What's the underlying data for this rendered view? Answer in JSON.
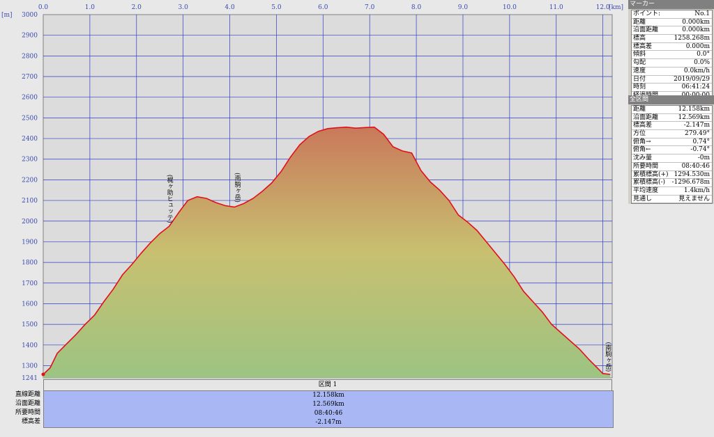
{
  "chart_data": {
    "type": "area",
    "xlabel_unit": "[km]",
    "ylabel_unit": "[m]",
    "xlim": [
      0.0,
      12.2
    ],
    "ylim": [
      1241,
      3000
    ],
    "x_ticks": [
      "0.0",
      "1.0",
      "2.0",
      "3.0",
      "4.0",
      "5.0",
      "6.0",
      "7.0",
      "8.0",
      "9.0",
      "10.0",
      "11.0",
      "12.0"
    ],
    "y_ticks": [
      "3000",
      "2900",
      "2800",
      "2700",
      "2600",
      "2500",
      "2400",
      "2300",
      "2200",
      "2100",
      "2000",
      "1900",
      "1800",
      "1700",
      "1600",
      "1500",
      "1400",
      "1300",
      "1241"
    ],
    "profile": [
      [
        0.0,
        1258
      ],
      [
        0.15,
        1290
      ],
      [
        0.3,
        1360
      ],
      [
        0.5,
        1405
      ],
      [
        0.7,
        1450
      ],
      [
        0.9,
        1500
      ],
      [
        1.1,
        1545
      ],
      [
        1.3,
        1610
      ],
      [
        1.5,
        1670
      ],
      [
        1.7,
        1740
      ],
      [
        1.9,
        1790
      ],
      [
        2.1,
        1845
      ],
      [
        2.3,
        1895
      ],
      [
        2.5,
        1940
      ],
      [
        2.7,
        1975
      ],
      [
        2.9,
        2040
      ],
      [
        3.1,
        2100
      ],
      [
        3.3,
        2118
      ],
      [
        3.5,
        2110
      ],
      [
        3.7,
        2090
      ],
      [
        3.9,
        2075
      ],
      [
        4.1,
        2068
      ],
      [
        4.3,
        2085
      ],
      [
        4.5,
        2110
      ],
      [
        4.7,
        2145
      ],
      [
        4.9,
        2185
      ],
      [
        5.1,
        2240
      ],
      [
        5.3,
        2310
      ],
      [
        5.5,
        2370
      ],
      [
        5.7,
        2410
      ],
      [
        5.9,
        2435
      ],
      [
        6.1,
        2448
      ],
      [
        6.3,
        2452
      ],
      [
        6.5,
        2455
      ],
      [
        6.7,
        2450
      ],
      [
        6.9,
        2453
      ],
      [
        7.1,
        2455
      ],
      [
        7.3,
        2420
      ],
      [
        7.5,
        2360
      ],
      [
        7.7,
        2340
      ],
      [
        7.9,
        2330
      ],
      [
        8.1,
        2245
      ],
      [
        8.3,
        2190
      ],
      [
        8.5,
        2150
      ],
      [
        8.7,
        2100
      ],
      [
        8.9,
        2030
      ],
      [
        9.1,
        1995
      ],
      [
        9.3,
        1955
      ],
      [
        9.5,
        1900
      ],
      [
        9.7,
        1845
      ],
      [
        9.9,
        1790
      ],
      [
        10.1,
        1730
      ],
      [
        10.3,
        1660
      ],
      [
        10.5,
        1610
      ],
      [
        10.7,
        1560
      ],
      [
        10.9,
        1500
      ],
      [
        11.1,
        1460
      ],
      [
        11.3,
        1420
      ],
      [
        11.5,
        1380
      ],
      [
        11.7,
        1330
      ],
      [
        11.9,
        1285
      ],
      [
        12.0,
        1262
      ],
      [
        12.158,
        1258
      ]
    ],
    "annotations": [
      {
        "x": 2.7,
        "y": 1990,
        "label": "(梶ヶ助ヒュッテ)"
      },
      {
        "x": 4.15,
        "y": 2090,
        "label": "(南駒ヶ岳)"
      },
      {
        "x": 12.1,
        "y": 1270,
        "label": "(南駒ヶ岳)"
      }
    ]
  },
  "marker_panel": {
    "title": "マーカー",
    "rows": [
      {
        "label": "ポイント:",
        "value": "No.1"
      },
      {
        "label": "距離",
        "value": "0.000km"
      },
      {
        "label": "沿面距離",
        "value": "0.000km"
      },
      {
        "label": "標高",
        "value": "1258.268m"
      },
      {
        "label": "標高差",
        "value": "0.000m"
      },
      {
        "label": "傾斜",
        "value": "0.0°"
      },
      {
        "label": "勾配",
        "value": "0.0%"
      },
      {
        "label": "速度",
        "value": "0.0km/h"
      },
      {
        "label": "日付",
        "value": "2019/09/29"
      },
      {
        "label": "時刻",
        "value": "06:41:24"
      },
      {
        "label": "経過時間",
        "value": "00:00:00"
      }
    ]
  },
  "total_panel": {
    "title": "全区間",
    "rows": [
      {
        "label": "距離",
        "value": "12.158km"
      },
      {
        "label": "沿面距離",
        "value": "12.569km"
      },
      {
        "label": "標高差",
        "value": "-2.147m"
      },
      {
        "label": "方位",
        "value": "279.49°"
      },
      {
        "label": "俯角→",
        "value": "0.74°"
      },
      {
        "label": "俯角←",
        "value": "-0.74°"
      },
      {
        "label": "沈み量",
        "value": "-0m"
      },
      {
        "label": "所要時間",
        "value": "08:40:46"
      },
      {
        "label": "累積標高(+)",
        "value": "1294.530m"
      },
      {
        "label": "累積標高(-)",
        "value": "-1296.678m"
      },
      {
        "label": "平均速度",
        "value": "1.4km/h"
      },
      {
        "label": "見通し",
        "value": "見えません"
      }
    ]
  },
  "summary": {
    "header": "区間 1",
    "labels": [
      "直線距離",
      "沿面距離",
      "所要時間",
      "標高差"
    ],
    "values": [
      "12.158km",
      "12.569km",
      "08:40:46",
      "-2.147m"
    ]
  },
  "colors": {
    "plot_bg": "#dcdcdc",
    "grid": "#2c3cc8",
    "profile_line": "#e0101a",
    "fill_top": "#c9795a",
    "fill_mid": "#c8c070",
    "fill_bottom": "#9cc482",
    "summary_bg": "#a9b8f5"
  }
}
